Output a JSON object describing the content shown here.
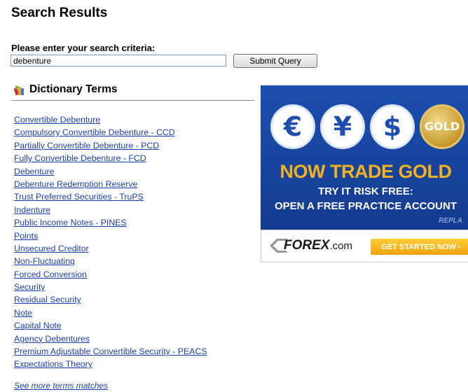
{
  "page": {
    "title": "Search Results"
  },
  "search": {
    "label": "Please enter your search criteria:",
    "value": "debenture",
    "submit_label": "Submit Query"
  },
  "dictionary": {
    "title": "Dictionary Terms",
    "icon": "dictionary-books-icon",
    "terms": [
      "Convertible Debenture",
      "Compulsory Convertible Debenture - CCD",
      "Partially Convertible Debenture - PCD",
      "Fully Convertible Debenture - FCD",
      "Debenture",
      "Debenture Redemption Reserve",
      "Trust Preferred Securities - TruPS",
      "Indenture",
      "Public Income Notes - PINES",
      "Points",
      "Unsecured Creditor",
      "Non-Fluctuating",
      "Forced Conversion",
      "Security",
      "Residual Security",
      "Note",
      "Capital Note",
      "Agency Debentures",
      "Premium Adjustable Convertible Security - PEACS",
      "Expectations Theory"
    ],
    "see_more": "See more terms matches"
  },
  "ad": {
    "coins": [
      "€",
      "¥",
      "$",
      "GOLD"
    ],
    "headline": "NOW TRADE GOLD",
    "line1": "TRY IT RISK FREE:",
    "line2": "OPEN A FREE PRACTICE ACCOUNT",
    "replay": "REPLA",
    "brand": "FOREX",
    "brand_suffix": ".com",
    "cta": "GET STARTED NOW ›",
    "colors": {
      "background": "#1c4fb0",
      "headline": "#f2b21f",
      "cta": "#f0a20a"
    }
  },
  "colors": {
    "link": "#1a3fb3"
  }
}
